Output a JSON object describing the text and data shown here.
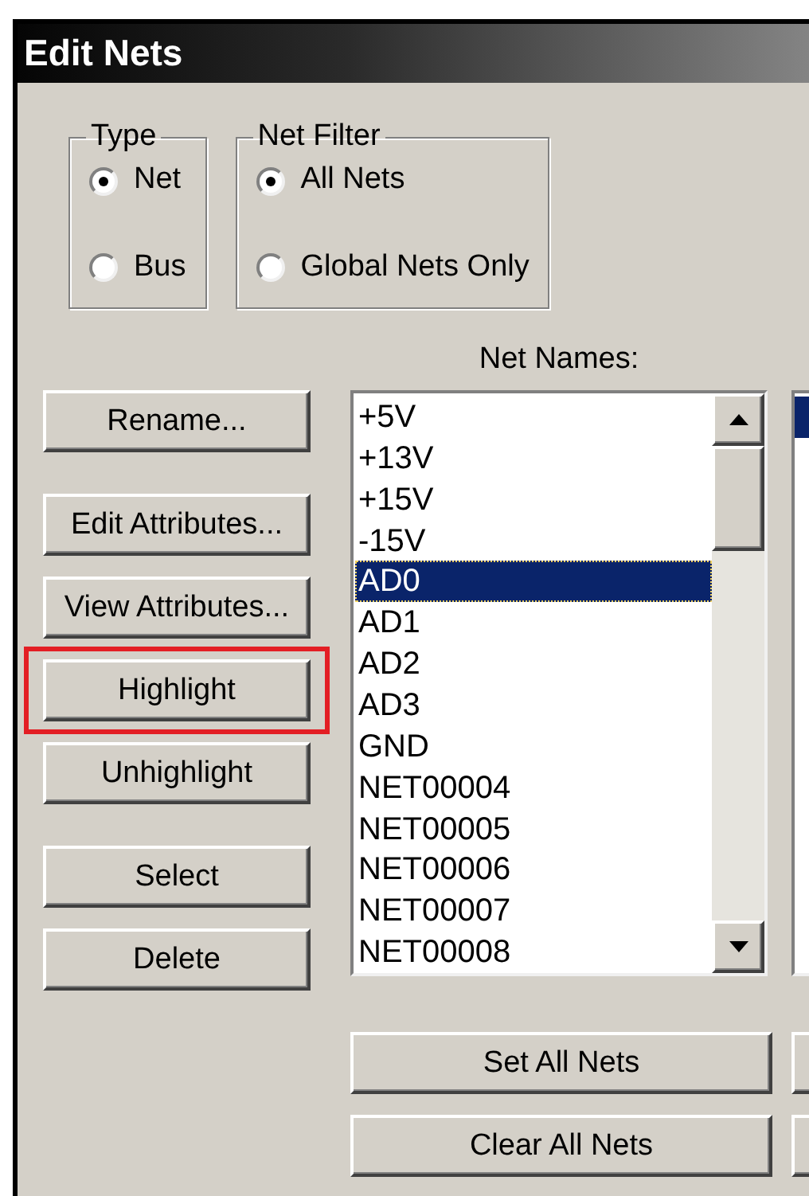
{
  "window": {
    "title": "Edit Nets"
  },
  "groups": [
    {
      "title": "Type",
      "options": [
        {
          "label": "Net",
          "selected": true
        },
        {
          "label": "Bus",
          "selected": false
        }
      ]
    },
    {
      "title": "Net Filter",
      "options": [
        {
          "label": "All Nets",
          "selected": true
        },
        {
          "label": "Global Nets Only",
          "selected": false
        }
      ]
    }
  ],
  "net_names_label": "Net Names:",
  "button_groups": [
    [
      {
        "label": "Rename...",
        "annotated": false
      }
    ],
    [
      {
        "label": "Edit Attributes...",
        "annotated": false
      },
      {
        "label": "View Attributes...",
        "annotated": false
      },
      {
        "label": "Highlight",
        "annotated": true
      },
      {
        "label": "Unhighlight",
        "annotated": false
      }
    ],
    [
      {
        "label": "Select",
        "annotated": false
      },
      {
        "label": "Delete",
        "annotated": false
      }
    ]
  ],
  "net_list": [
    {
      "label": "+5V",
      "selected": false
    },
    {
      "label": "+13V",
      "selected": false
    },
    {
      "label": "+15V",
      "selected": false
    },
    {
      "label": "-15V",
      "selected": false
    },
    {
      "label": "AD0",
      "selected": true
    },
    {
      "label": "AD1",
      "selected": false
    },
    {
      "label": "AD2",
      "selected": false
    },
    {
      "label": "AD3",
      "selected": false
    },
    {
      "label": "GND",
      "selected": false
    },
    {
      "label": "NET00004",
      "selected": false
    },
    {
      "label": "NET00005",
      "selected": false
    },
    {
      "label": "NET00006",
      "selected": false
    },
    {
      "label": "NET00007",
      "selected": false
    },
    {
      "label": "NET00008",
      "selected": false
    }
  ],
  "bottom_buttons": [
    "Set All Nets",
    "Clear All Nets"
  ]
}
